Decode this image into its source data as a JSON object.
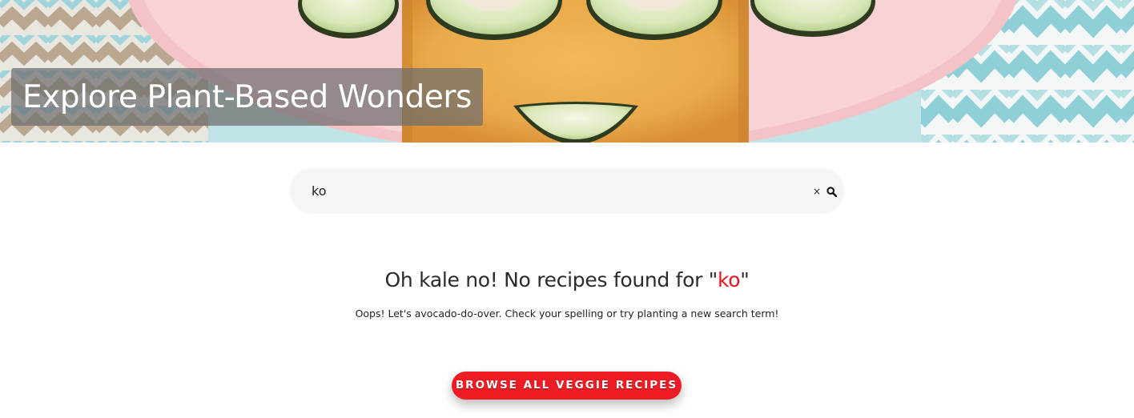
{
  "hero": {
    "title": "Explore Plant-Based Wonders"
  },
  "search": {
    "value": "ko",
    "clear_label": "×",
    "search_icon": "magnifier-icon",
    "clear_icon": "close-icon"
  },
  "results": {
    "heading_prefix": "Oh kale no! No recipes found for \"",
    "heading_term": "ko",
    "heading_suffix": "\"",
    "subtext": "Oops! Let's avocado-do-over. Check your spelling or try planting a new search term!"
  },
  "cta": {
    "label": "BROWSE ALL VEGGIE RECIPES"
  },
  "colors": {
    "accent_red": "#ee1c25",
    "term_red": "#e8141e",
    "hero_plate_pink": "#f7cfd2",
    "hero_cloth_teal": "#a9dbe0",
    "search_bg": "#f5f5f5"
  }
}
